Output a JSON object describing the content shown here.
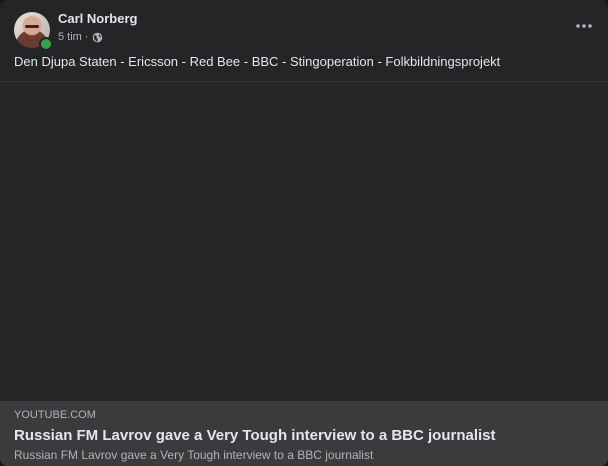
{
  "post": {
    "author": "Carl Norberg",
    "time": "5 tim",
    "separator": "·",
    "privacy_icon": "globe-icon",
    "text": "Den Djupa Staten - Ericsson - Red Bee - BBC - Stingoperation - Folkbildningsprojekt",
    "more_icon": "more-horizontal-icon"
  },
  "link_preview": {
    "domain": "YOUTUBE.COM",
    "title": "Russian FM Lavrov gave a Very Tough interview to a BBC journalist",
    "description": "Russian FM Lavrov gave a Very Tough interview to a BBC journalist"
  },
  "colors": {
    "card_bg": "#242526",
    "preview_bg": "#3a3b3c",
    "text_primary": "#e4e6eb",
    "text_secondary": "#b0b3b8",
    "online": "#31a24c"
  }
}
